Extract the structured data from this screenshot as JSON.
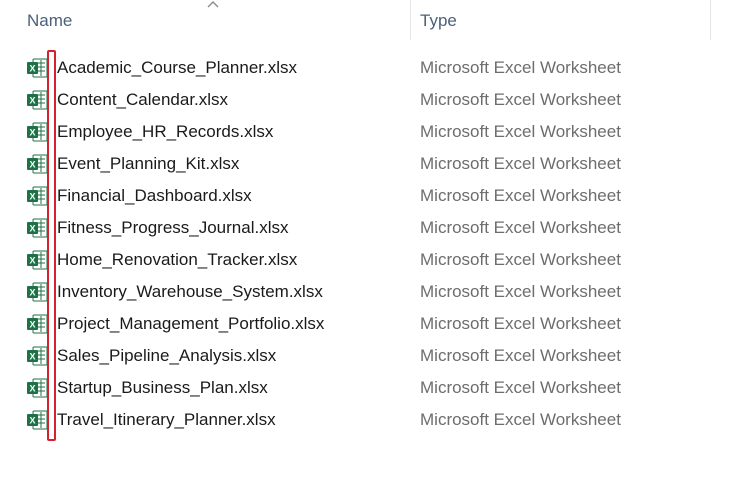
{
  "header": {
    "name_label": "Name",
    "type_label": "Type",
    "sort": "ascending"
  },
  "files": [
    {
      "name": "Academic_Course_Planner.xlsx",
      "type": "Microsoft Excel Worksheet",
      "icon": "excel-file-icon"
    },
    {
      "name": "Content_Calendar.xlsx",
      "type": "Microsoft Excel Worksheet",
      "icon": "excel-file-icon"
    },
    {
      "name": "Employee_HR_Records.xlsx",
      "type": "Microsoft Excel Worksheet",
      "icon": "excel-file-icon"
    },
    {
      "name": "Event_Planning_Kit.xlsx",
      "type": "Microsoft Excel Worksheet",
      "icon": "excel-file-icon"
    },
    {
      "name": "Financial_Dashboard.xlsx",
      "type": "Microsoft Excel Worksheet",
      "icon": "excel-file-icon"
    },
    {
      "name": "Fitness_Progress_Journal.xlsx",
      "type": "Microsoft Excel Worksheet",
      "icon": "excel-file-icon"
    },
    {
      "name": "Home_Renovation_Tracker.xlsx",
      "type": "Microsoft Excel Worksheet",
      "icon": "excel-file-icon"
    },
    {
      "name": "Inventory_Warehouse_System.xlsx",
      "type": "Microsoft Excel Worksheet",
      "icon": "excel-file-icon"
    },
    {
      "name": "Project_Management_Portfolio.xlsx",
      "type": "Microsoft Excel Worksheet",
      "icon": "excel-file-icon"
    },
    {
      "name": "Sales_Pipeline_Analysis.xlsx",
      "type": "Microsoft Excel Worksheet",
      "icon": "excel-file-icon"
    },
    {
      "name": "Startup_Business_Plan.xlsx",
      "type": "Microsoft Excel Worksheet",
      "icon": "excel-file-icon"
    },
    {
      "name": "Travel_Itinerary_Planner.xlsx",
      "type": "Microsoft Excel Worksheet",
      "icon": "excel-file-icon"
    }
  ],
  "colors": {
    "excel_green": "#1e7145",
    "highlight_red": "#d4232f",
    "header_text": "#4c607a"
  }
}
